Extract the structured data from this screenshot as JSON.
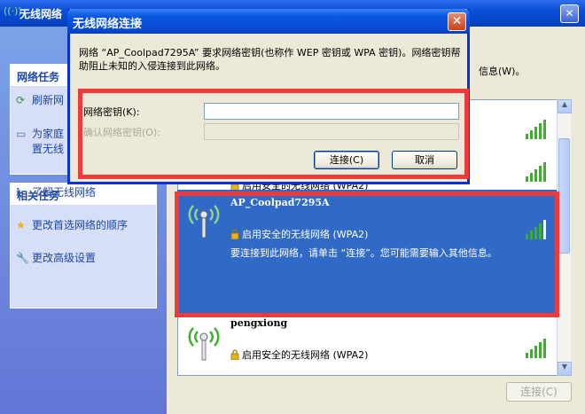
{
  "background_window": {
    "title": "无线网络",
    "tasks_header": "网络任务",
    "tasks": [
      {
        "label": "刷新网",
        "icon": "refresh-icon"
      },
      {
        "label": "为家庭",
        "label2": "置无线",
        "icon": "network-setup-icon"
      }
    ],
    "related_header": "相关任务",
    "related": [
      {
        "label": "了解无线网络",
        "icon": "info-icon"
      },
      {
        "label": "更改首选网络的顺序",
        "icon": "star-icon"
      },
      {
        "label": "更改高级设置",
        "icon": "wrench-icon"
      }
    ],
    "list_hint_suffix": "信息(W)。",
    "connect_label": "连接(C)"
  },
  "networks": [
    {
      "name": "",
      "security": "启用安全的无线网络 (WPA2)",
      "partial": true
    },
    {
      "name": "AP_Coolpad7295A",
      "security": "启用安全的无线网络 (WPA2)",
      "hint": "要连接到此网络，请单击 “连接”。您可能需要输入其他信息。",
      "selected": true
    },
    {
      "name": "pengxiong",
      "security": "启用安全的无线网络 (WPA2)"
    }
  ],
  "dialog": {
    "title": "无线网络连接",
    "close_glyph": "✕",
    "message": "网络 “AP_Coolpad7295A” 要求网络密钥(也称作 WEP 密钥或 WPA 密钥)。网络密钥帮助阻止未知的入侵连接到此网络。",
    "key_label": "网络密钥(K):",
    "key_value": "",
    "confirm_label": "确认网络密钥(O):",
    "confirm_value": "",
    "connect_button": "连接(C)",
    "cancel_button": "取消"
  },
  "colors": {
    "highlight_red": "#ee3a3a",
    "selection_blue": "#3169c6",
    "signal_green": "#3bb12b"
  }
}
